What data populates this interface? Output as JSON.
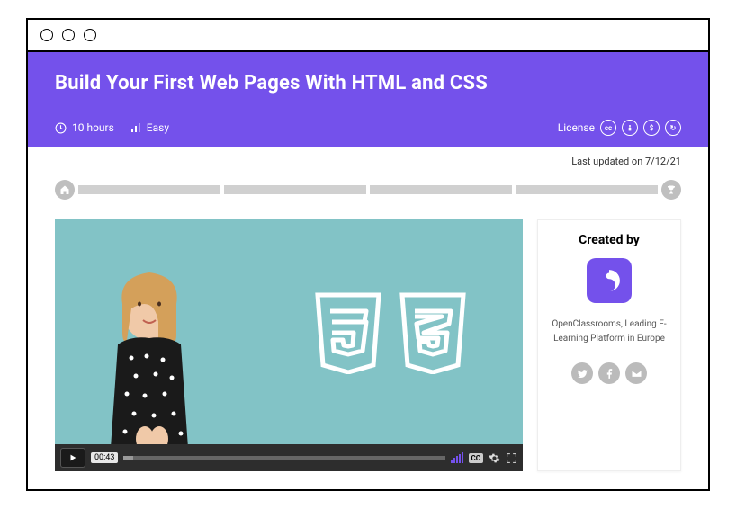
{
  "hero": {
    "title": "Build Your First Web Pages With HTML and CSS",
    "duration": "10 hours",
    "difficulty": "Easy",
    "license_label": "License"
  },
  "updated": "Last updated on 7/12/21",
  "video": {
    "timecode": "00:43",
    "cc_label": "CC"
  },
  "creator": {
    "heading": "Created by",
    "description": "OpenClassrooms, Leading E-Learning Platform in Europe"
  }
}
